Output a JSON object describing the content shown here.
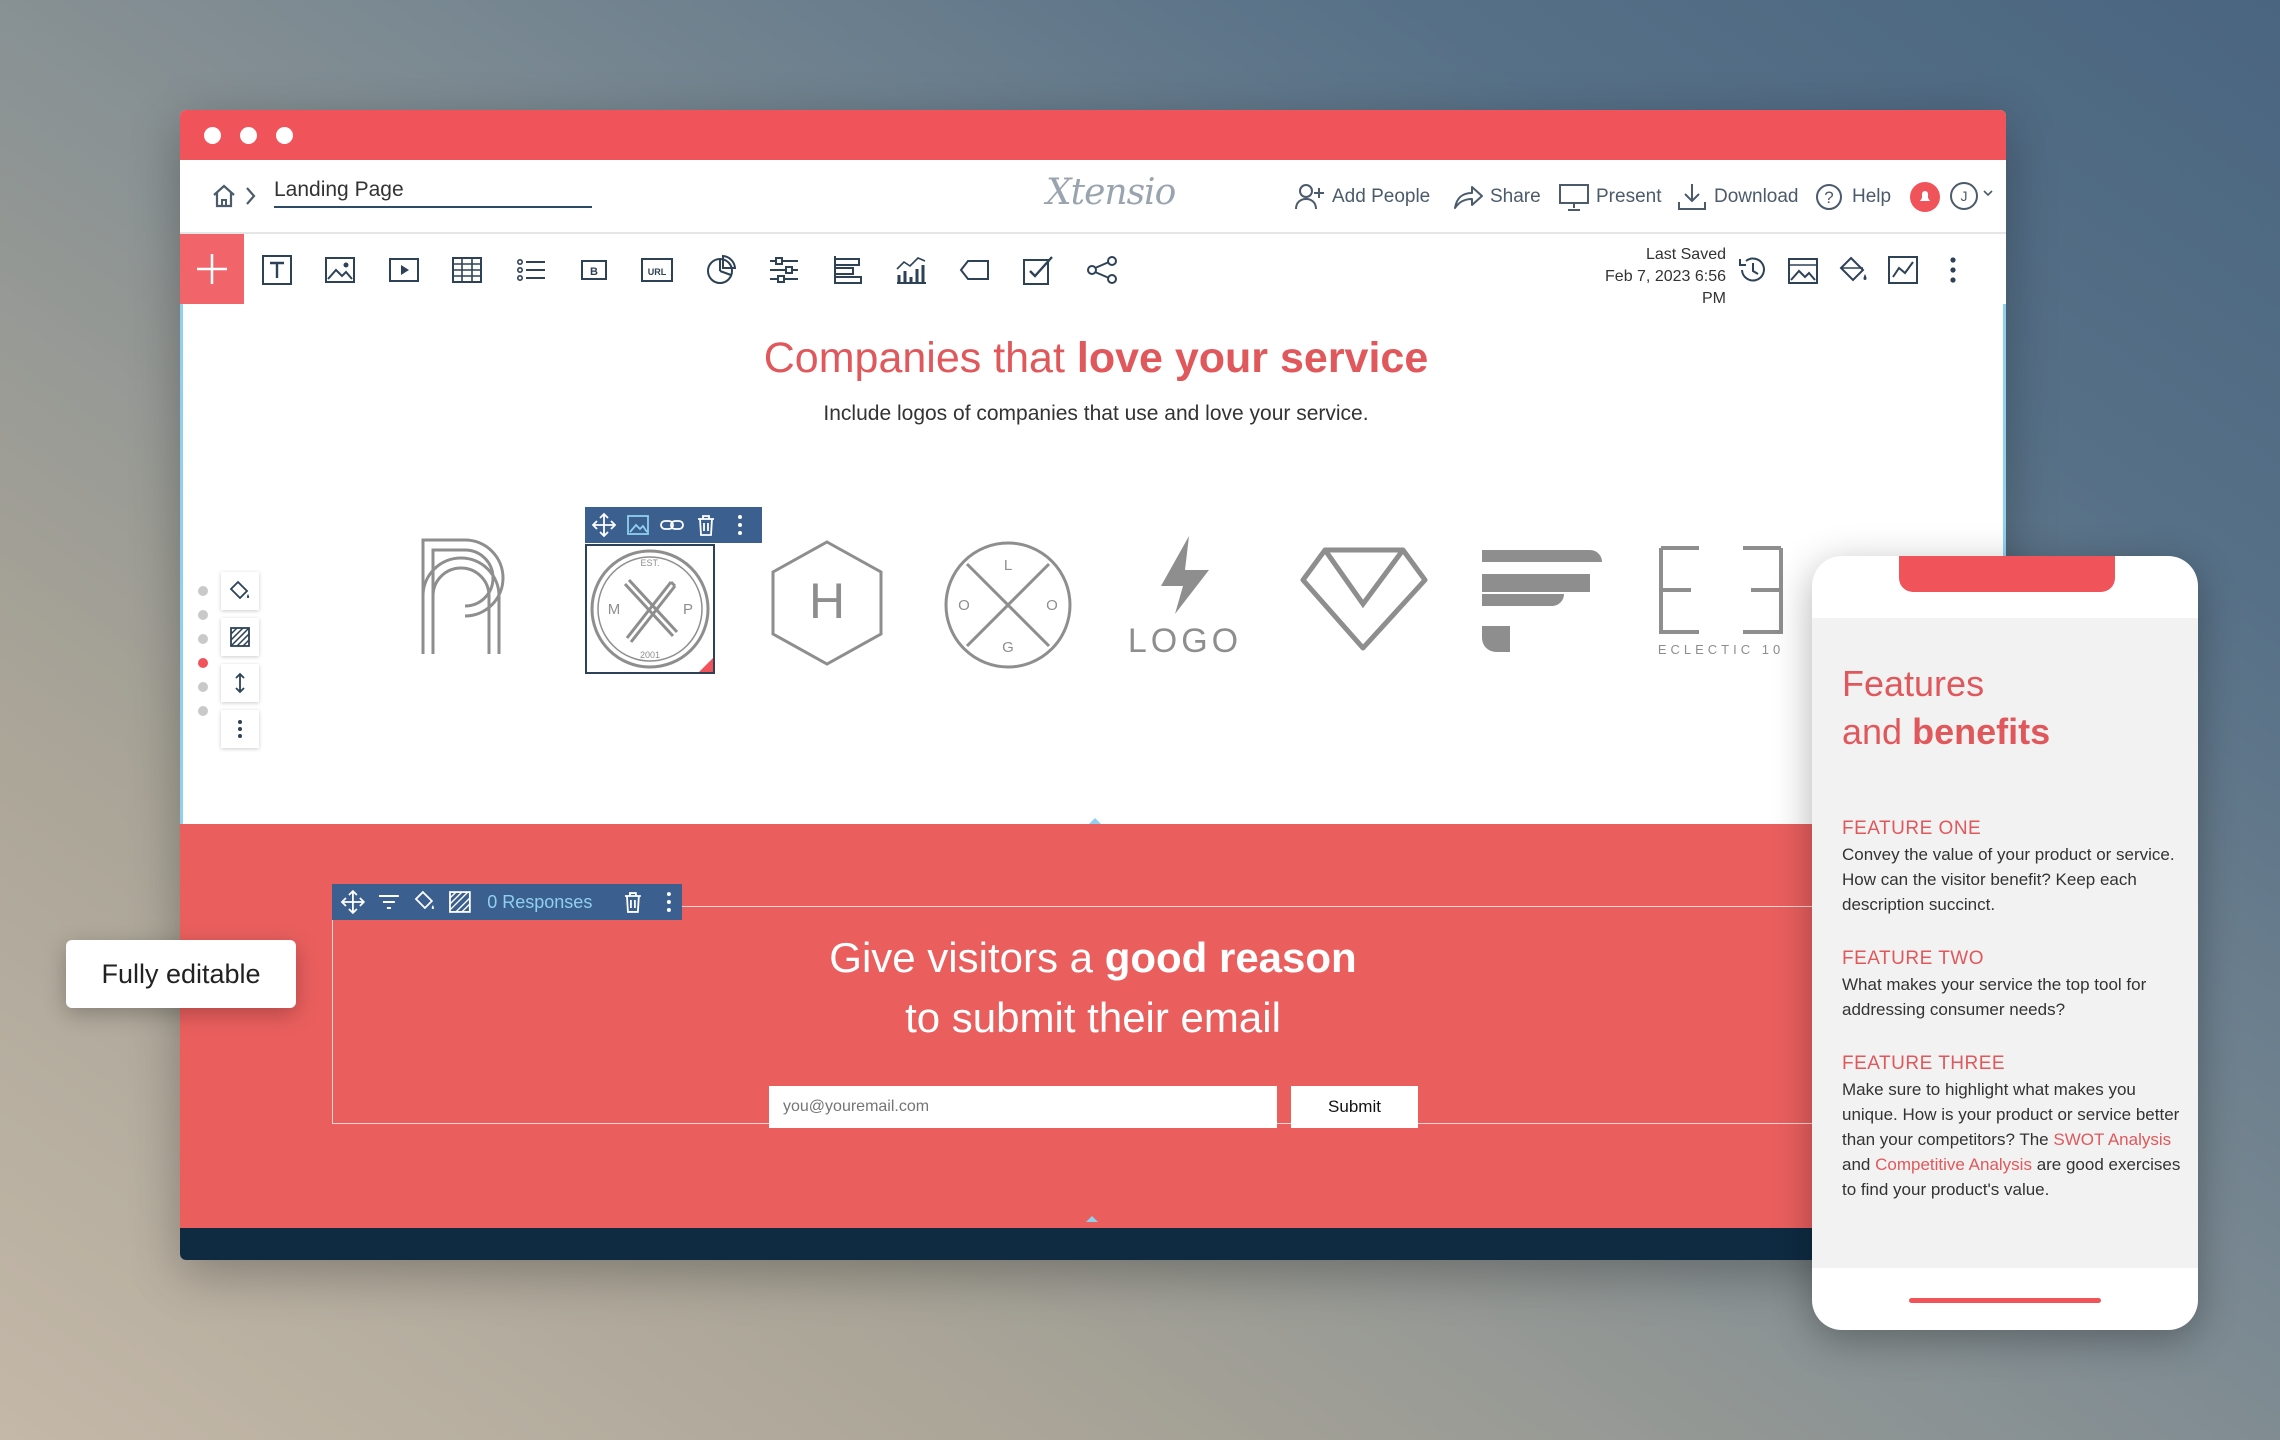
{
  "window": {
    "breadcrumb_page": "Landing Page",
    "brand": "Xtensio",
    "nav_actions": [
      "Add People",
      "Share",
      "Present",
      "Download",
      "Help"
    ],
    "avatar_initial": "J",
    "last_saved_label": "Last Saved",
    "last_saved_time": "Feb 7, 2023 6:56 PM",
    "toolbar_icons": [
      "text-icon",
      "image-icon",
      "video-icon",
      "table-icon",
      "list-icon",
      "button-icon",
      "url-icon",
      "pie-chart-icon",
      "sliders-icon",
      "bar-align-icon",
      "line-chart-icon",
      "tag-icon",
      "form-icon",
      "share-nodes-icon"
    ],
    "right_toolbar_icons": [
      "history-icon",
      "background-image-icon",
      "paint-icon",
      "analytics-icon",
      "more-icon"
    ]
  },
  "logos_section": {
    "title_light": "Companies that",
    "title_bold": "love your service",
    "subtitle": "Include logos of companies that use and love your service.",
    "logos": [
      {
        "name": "logo-r"
      },
      {
        "name": "logo-mp",
        "top": "EST.",
        "left": "M",
        "right": "P",
        "bottom": "2001"
      },
      {
        "name": "logo-h",
        "letter": "H"
      },
      {
        "name": "logo-circle",
        "letters": [
          "L",
          "O",
          "O",
          "G"
        ]
      },
      {
        "name": "logo-bolt",
        "text": "LOGO"
      },
      {
        "name": "logo-diamond"
      },
      {
        "name": "logo-f"
      },
      {
        "name": "logo-ee",
        "text": "ECLECTIC 10"
      }
    ]
  },
  "email_section": {
    "toolbar_responses": "0 Responses",
    "title_line1_light": "Give visitors a",
    "title_line1_bold": "good reason",
    "title_line2": "to submit their email",
    "email_placeholder": "you@youremail.com",
    "submit_label": "Submit"
  },
  "badge": {
    "label": "Fully editable"
  },
  "phone": {
    "title_line1": "Features",
    "title_line2_light": "and",
    "title_line2_bold": "benefits",
    "features": [
      {
        "title": "FEATURE ONE",
        "desc": "Convey the value of your product or service. How can the visitor benefit? Keep each description succinct."
      },
      {
        "title": "FEATURE TWO",
        "desc": "What makes your service the top tool for addressing consumer needs?"
      },
      {
        "title": "FEATURE THREE",
        "desc_pre": "Make sure to highlight what makes you unique. How is your product or service better than your competitors? The",
        "link1": "SWOT Analysis",
        "mid": "and",
        "link2": "Competitive Analysis",
        "desc_post": "are good exercises to find your product's value."
      }
    ]
  },
  "colors": {
    "accent": "#f0535a",
    "section_red": "#ea5f5e",
    "dark_footer": "#0e2b42",
    "element_toolbar": "#3b5f8f"
  }
}
